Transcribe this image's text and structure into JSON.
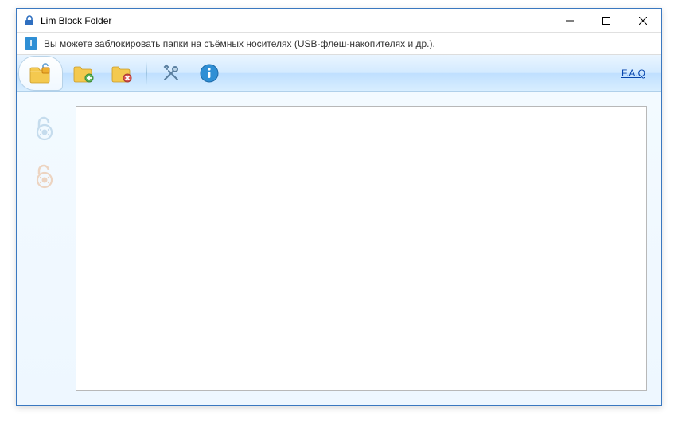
{
  "title": "Lim Block Folder",
  "infobar": {
    "text": "Вы можете заблокировать папки на съёмных носителях (USB-флеш-накопителях и др.)."
  },
  "toolbar": {
    "faq_label": "F.A.Q"
  },
  "icons": {
    "lock_folder": "lock-folder-icon",
    "add_folder": "add-folder-icon",
    "remove_folder": "remove-folder-icon",
    "settings": "settings-icon",
    "info": "info-icon",
    "unlock": "unlock-icon",
    "lock": "lock-icon"
  }
}
